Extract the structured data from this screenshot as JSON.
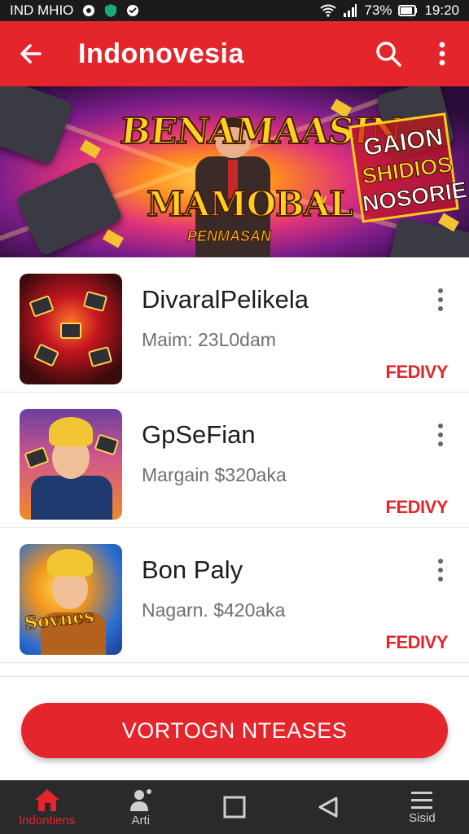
{
  "status_bar": {
    "left_text": "IND MHIO",
    "battery": "73%",
    "time": "19:20"
  },
  "app_bar": {
    "title": "Indonovesia",
    "back_icon": "arrow-left-icon",
    "search_icon": "search-icon",
    "more_icon": "more-vertical-icon"
  },
  "banner": {
    "title_line1": "BENAMAASIN",
    "title_line2": "MAMOBAL",
    "trademark": "TV",
    "subtitle": "PENMASAN",
    "side_line1": "GAION",
    "side_line2": "SHIDIOS",
    "side_line3": "NOSORIE"
  },
  "list": {
    "items": [
      {
        "title": "DivaralPelikela",
        "meta": "Maim: 23L0dam",
        "action": "FEDIVY"
      },
      {
        "title": "GpSeFian",
        "meta": "Margain  $320aka",
        "action": "FEDIVY"
      },
      {
        "title": "Bon Paly",
        "meta": "Nagarn. $420aka",
        "action": "FEDIVY",
        "thumb_text": "Sovnes"
      }
    ]
  },
  "cta": {
    "label": "VORTOGN NTEASES"
  },
  "bottom_nav": {
    "items": [
      {
        "label": "Indontiens",
        "icon": "home-icon"
      },
      {
        "label": "Arti",
        "icon": "person-icon"
      },
      {
        "label": "",
        "icon": "square-icon"
      },
      {
        "label": "",
        "icon": "back-triangle-icon"
      },
      {
        "label": "Sisid",
        "icon": "menu-icon"
      }
    ]
  },
  "colors": {
    "accent": "#e4262c",
    "status_bar": "#1b1b1b",
    "nav_bar": "#2a2a2a"
  }
}
